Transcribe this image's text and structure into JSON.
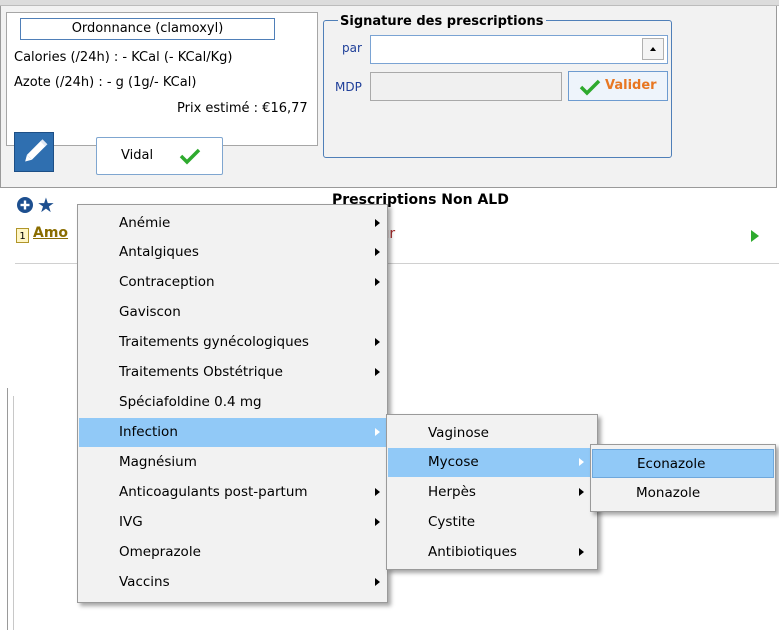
{
  "ordonnance": {
    "title": "Ordonnance (clamoxyl)",
    "calories": "Calories (/24h) : - KCal (- KCal/Kg)",
    "azote": "Azote (/24h) : - g (1g/- KCal)",
    "prix": "Prix estimé : €16,77"
  },
  "toolbar": {
    "vidal_label": "Vidal"
  },
  "signature": {
    "title": "Signature des prescriptions",
    "par_label": "par",
    "par_value": "",
    "mdp_label": "MDP",
    "mdp_value": "",
    "valider_label": "Valider"
  },
  "prescriptions": {
    "header": "Prescriptions Non ALD",
    "rows": [
      {
        "number": "1",
        "name_visible": "Amo",
        "detail_visible": "leur"
      }
    ]
  },
  "menu1": {
    "items": [
      {
        "label": "Anémie",
        "submenu": true
      },
      {
        "label": "Antalgiques",
        "submenu": true
      },
      {
        "label": "Contraception",
        "submenu": true
      },
      {
        "label": "Gaviscon",
        "submenu": false
      },
      {
        "label": "Traitements gynécologiques",
        "submenu": true
      },
      {
        "label": "Traitements Obstétrique",
        "submenu": true
      },
      {
        "label": "Spéciafoldine 0.4 mg",
        "submenu": false
      },
      {
        "label": "Infection",
        "submenu": true,
        "highlighted": true
      },
      {
        "label": "Magnésium",
        "submenu": false
      },
      {
        "label": "Anticoagulants post-partum",
        "submenu": true
      },
      {
        "label": "IVG",
        "submenu": true
      },
      {
        "label": "Omeprazole",
        "submenu": false
      },
      {
        "label": "Vaccins",
        "submenu": true
      }
    ]
  },
  "menu2": {
    "items": [
      {
        "label": "Vaginose",
        "submenu": false
      },
      {
        "label": "Mycose",
        "submenu": true,
        "highlighted": true
      },
      {
        "label": "Herpès",
        "submenu": true
      },
      {
        "label": "Cystite",
        "submenu": false
      },
      {
        "label": "Antibiotiques",
        "submenu": true
      }
    ]
  },
  "menu3": {
    "items": [
      {
        "label": "Econazole",
        "submenu": false,
        "highlighted": true
      },
      {
        "label": "Monazole",
        "submenu": false
      }
    ]
  },
  "colors": {
    "highlight": "#91c9f7",
    "valider_text": "#e87722",
    "check_green": "#2eaa2e",
    "edit_button": "#2f6fb0"
  },
  "icons": [
    "pencil-icon",
    "check-icon",
    "dropdown-arrow-icon",
    "plus-circle-icon",
    "star-icon",
    "submenu-arrow-icon",
    "play-arrow-icon"
  ]
}
